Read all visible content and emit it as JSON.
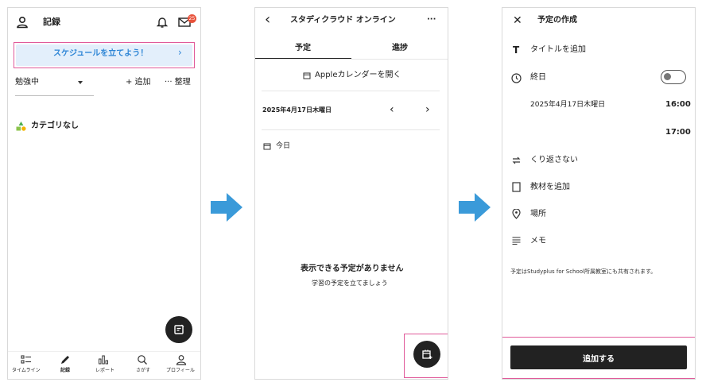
{
  "screen1": {
    "title": "記録",
    "badge": "25",
    "banner": "スケジュールを立てよう！",
    "banner_chevron": "›",
    "filter": "勉強中",
    "add": "+ 追加",
    "organize": "··· 整理",
    "category": "カテゴリなし",
    "nav": [
      "タイムライン",
      "記録",
      "レポート",
      "さがす",
      "プロフィール"
    ]
  },
  "screen2": {
    "title": "スタディクラウド オンライン",
    "more": "···",
    "tabs": [
      "予定",
      "進捗"
    ],
    "apple_calendar": "Appleカレンダーを開く",
    "date": "2025年4月17日木曜日",
    "prev": "‹",
    "next": "›",
    "today": "今日",
    "empty_title": "表示できる予定がありません",
    "empty_sub": "学習の予定を立てましょう"
  },
  "screen3": {
    "title": "予定の作成",
    "add_title": "タイトルを追加",
    "all_day": "終日",
    "date": "2025年4月17日木曜日",
    "start_time": "16:00",
    "end_time": "17:00",
    "repeat": "くり返さない",
    "material": "教材を追加",
    "place": "場所",
    "memo": "メモ",
    "note": "予定はStudyplus for School所属教室にも共有されます。",
    "submit": "追加する"
  },
  "colors": {
    "highlight": "#e05a9a",
    "banner_bg": "#e3effb",
    "banner_text": "#2e86d6",
    "arrow": "#3a9ad9",
    "badge": "#e8523b"
  }
}
